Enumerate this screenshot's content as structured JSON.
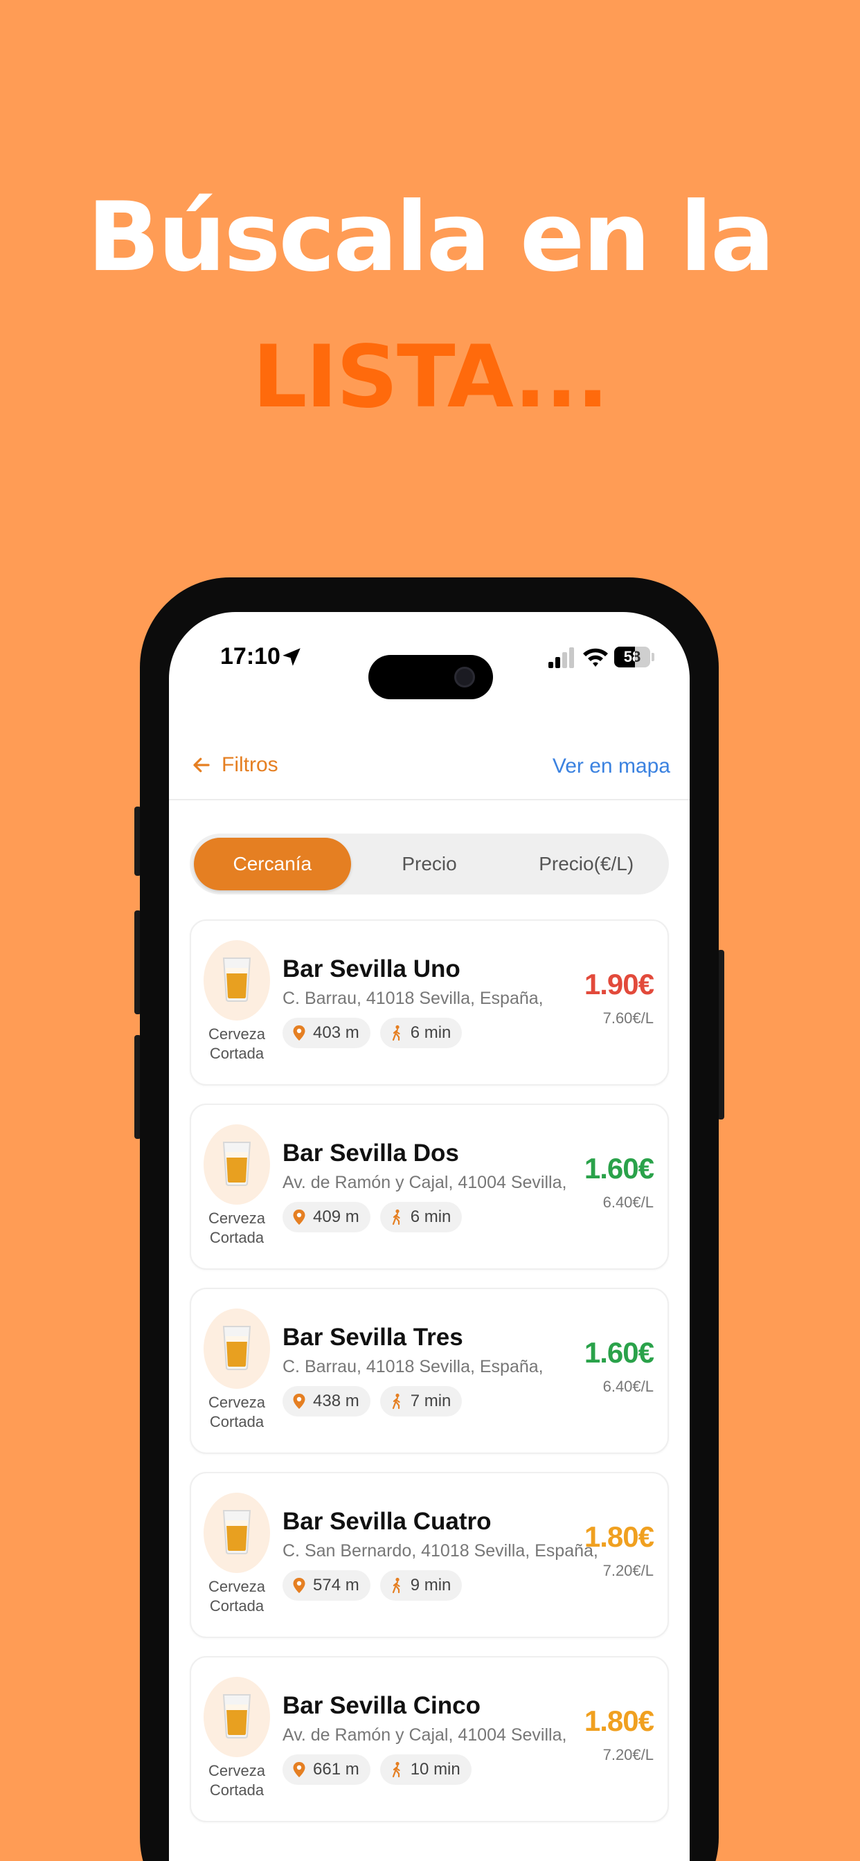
{
  "headline": {
    "line1": "Búscala en la",
    "line2": "LISTA..."
  },
  "status": {
    "time": "17:10",
    "battery": "58"
  },
  "nav": {
    "back_label": "Filtros",
    "map_label": "Ver en mapa"
  },
  "sort_tabs": [
    {
      "label": "Cercanía",
      "active": true
    },
    {
      "label": "Precio",
      "active": false
    },
    {
      "label": "Precio(€/L)",
      "active": false
    }
  ],
  "beer_type": {
    "line1": "Cerveza",
    "line2": "Cortada"
  },
  "bars": [
    {
      "name": "Bar Sevilla Uno",
      "address": "C. Barrau, 41018 Sevilla, España,",
      "distance": "403 m",
      "walk": "6 min",
      "price": "1.90€",
      "per_liter": "7.60€/L",
      "price_color": "#e24a3b"
    },
    {
      "name": "Bar Sevilla Dos",
      "address": "Av. de Ramón y Cajal, 41004 Sevilla,",
      "distance": "409 m",
      "walk": "6 min",
      "price": "1.60€",
      "per_liter": "6.40€/L",
      "price_color": "#2aa24a"
    },
    {
      "name": "Bar Sevilla Tres",
      "address": "C. Barrau, 41018 Sevilla, España,",
      "distance": "438 m",
      "walk": "7 min",
      "price": "1.60€",
      "per_liter": "6.40€/L",
      "price_color": "#2aa24a"
    },
    {
      "name": "Bar Sevilla Cuatro",
      "address": "C. San Bernardo, 41018 Sevilla, España,",
      "distance": "574 m",
      "walk": "9 min",
      "price": "1.80€",
      "per_liter": "7.20€/L",
      "price_color": "#f0a020"
    },
    {
      "name": "Bar Sevilla Cinco",
      "address": "Av. de Ramón y Cajal, 41004 Sevilla,",
      "distance": "661 m",
      "walk": "10 min",
      "price": "1.80€",
      "per_liter": "7.20€/L",
      "price_color": "#f0a020"
    }
  ],
  "icons": {
    "back": "arrow-left-icon",
    "location": "location-arrow-icon",
    "pin": "map-pin-icon",
    "walk": "walking-icon",
    "beer": "beer-glass-icon"
  },
  "colors": {
    "background": "#ff9c55",
    "accent": "#e57f22",
    "headline_accent": "#ff6a0c",
    "link": "#3b82e0"
  }
}
